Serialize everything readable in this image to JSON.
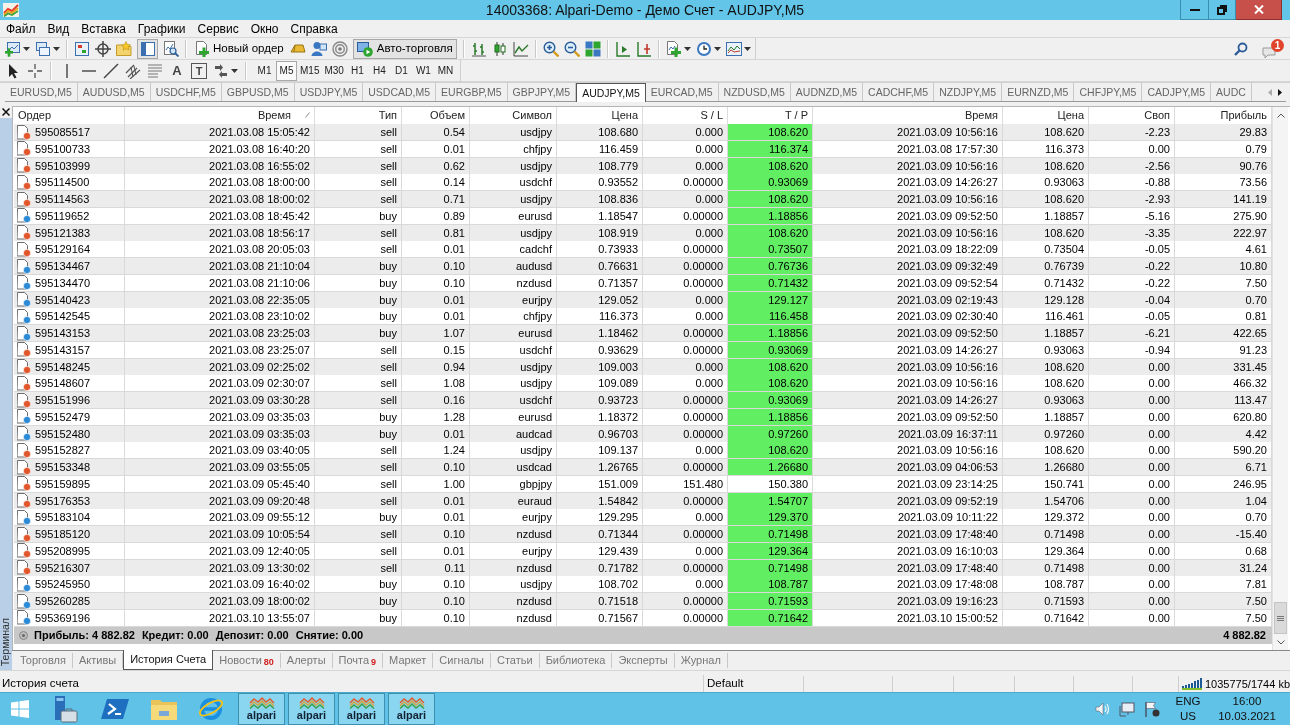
{
  "window": {
    "title": "14003368: Alpari-Demo - Демо Счет - AUDJPY,M5"
  },
  "menu": [
    "Файл",
    "Вид",
    "Вставка",
    "Графики",
    "Сервис",
    "Окно",
    "Справка"
  ],
  "toolbar": {
    "new_order": "Новый ордер",
    "auto_trading": {
      "label": "Авто-торговля",
      "on": true
    },
    "notifications_badge": "1"
  },
  "drawing_toolbar": {
    "text_tool": "A",
    "label_tool": "T",
    "timeframes": [
      {
        "label": "M1",
        "selected": false
      },
      {
        "label": "M5",
        "selected": true
      },
      {
        "label": "M15",
        "selected": false
      },
      {
        "label": "M30",
        "selected": false
      },
      {
        "label": "H1",
        "selected": false
      },
      {
        "label": "H4",
        "selected": false
      },
      {
        "label": "D1",
        "selected": false
      },
      {
        "label": "W1",
        "selected": false
      },
      {
        "label": "MN",
        "selected": false
      }
    ]
  },
  "chart_tabs": [
    {
      "label": "EURUSD,M5",
      "selected": false
    },
    {
      "label": "AUDUSD,M5",
      "selected": false
    },
    {
      "label": "USDCHF,M5",
      "selected": false
    },
    {
      "label": "GBPUSD,M5",
      "selected": false
    },
    {
      "label": "USDJPY,M5",
      "selected": false
    },
    {
      "label": "USDCAD,M5",
      "selected": false
    },
    {
      "label": "EURGBP,M5",
      "selected": false
    },
    {
      "label": "GBPJPY,M5",
      "selected": false
    },
    {
      "label": "AUDJPY,M5",
      "selected": true
    },
    {
      "label": "EURCAD,M5",
      "selected": false
    },
    {
      "label": "NZDUSD,M5",
      "selected": false
    },
    {
      "label": "AUDNZD,M5",
      "selected": false
    },
    {
      "label": "CADCHF,M5",
      "selected": false
    },
    {
      "label": "NZDJPY,M5",
      "selected": false
    },
    {
      "label": "EURNZD,M5",
      "selected": false
    },
    {
      "label": "CHFJPY,M5",
      "selected": false
    },
    {
      "label": "CADJPY,M5",
      "selected": false
    },
    {
      "label": "AUDC",
      "selected": false
    }
  ],
  "terminal": {
    "title": "Терминал",
    "table": {
      "columns": [
        {
          "label": "Ордер",
          "sorted": false
        },
        {
          "label": "Время",
          "sorted": true
        },
        {
          "label": "Тип",
          "sorted": false
        },
        {
          "label": "Объем",
          "sorted": false
        },
        {
          "label": "Символ",
          "sorted": false
        },
        {
          "label": "Цена",
          "sorted": false
        },
        {
          "label": "S / L",
          "sorted": false
        },
        {
          "label": "T / P",
          "sorted": false
        },
        {
          "label": "Время",
          "sorted": false
        },
        {
          "label": "Цена",
          "sorted": false
        },
        {
          "label": "Своп",
          "sorted": false
        },
        {
          "label": "Прибыль",
          "sorted": false
        }
      ],
      "rows": [
        {
          "kind": "sell",
          "order": "595085517",
          "open_time": "2021.03.08 15:05:42",
          "type": "sell",
          "volume": "0.54",
          "symbol": "usdjpy",
          "open_price": "108.680",
          "sl": "0.000",
          "tp": "108.620",
          "tp_hit": true,
          "close_time": "2021.03.09 10:56:16",
          "close_price": "108.620",
          "swap": "-2.23",
          "profit": "29.83"
        },
        {
          "kind": "sell",
          "order": "595100733",
          "open_time": "2021.03.08 16:40:20",
          "type": "sell",
          "volume": "0.01",
          "symbol": "chfjpy",
          "open_price": "116.459",
          "sl": "0.000",
          "tp": "116.374",
          "tp_hit": true,
          "close_time": "2021.03.08 17:57:30",
          "close_price": "116.373",
          "swap": "0.00",
          "profit": "0.79"
        },
        {
          "kind": "sell",
          "order": "595103999",
          "open_time": "2021.03.08 16:55:02",
          "type": "sell",
          "volume": "0.62",
          "symbol": "usdjpy",
          "open_price": "108.779",
          "sl": "0.000",
          "tp": "108.620",
          "tp_hit": true,
          "close_time": "2021.03.09 10:56:16",
          "close_price": "108.620",
          "swap": "-2.56",
          "profit": "90.76"
        },
        {
          "kind": "sell",
          "order": "595114500",
          "open_time": "2021.03.08 18:00:00",
          "type": "sell",
          "volume": "0.14",
          "symbol": "usdchf",
          "open_price": "0.93552",
          "sl": "0.00000",
          "tp": "0.93069",
          "tp_hit": true,
          "close_time": "2021.03.09 14:26:27",
          "close_price": "0.93063",
          "swap": "-0.88",
          "profit": "73.56"
        },
        {
          "kind": "sell",
          "order": "595114563",
          "open_time": "2021.03.08 18:00:02",
          "type": "sell",
          "volume": "0.71",
          "symbol": "usdjpy",
          "open_price": "108.836",
          "sl": "0.000",
          "tp": "108.620",
          "tp_hit": true,
          "close_time": "2021.03.09 10:56:16",
          "close_price": "108.620",
          "swap": "-2.93",
          "profit": "141.19"
        },
        {
          "kind": "buy",
          "order": "595119652",
          "open_time": "2021.03.08 18:45:42",
          "type": "buy",
          "volume": "0.89",
          "symbol": "eurusd",
          "open_price": "1.18547",
          "sl": "0.00000",
          "tp": "1.18856",
          "tp_hit": true,
          "close_time": "2021.03.09 09:52:50",
          "close_price": "1.18857",
          "swap": "-5.16",
          "profit": "275.90"
        },
        {
          "kind": "sell",
          "order": "595121383",
          "open_time": "2021.03.08 18:56:17",
          "type": "sell",
          "volume": "0.81",
          "symbol": "usdjpy",
          "open_price": "108.919",
          "sl": "0.000",
          "tp": "108.620",
          "tp_hit": true,
          "close_time": "2021.03.09 10:56:16",
          "close_price": "108.620",
          "swap": "-3.35",
          "profit": "222.97"
        },
        {
          "kind": "sell",
          "order": "595129164",
          "open_time": "2021.03.08 20:05:03",
          "type": "sell",
          "volume": "0.01",
          "symbol": "cadchf",
          "open_price": "0.73933",
          "sl": "0.00000",
          "tp": "0.73507",
          "tp_hit": true,
          "close_time": "2021.03.09 18:22:09",
          "close_price": "0.73504",
          "swap": "-0.05",
          "profit": "4.61"
        },
        {
          "kind": "buy",
          "order": "595134467",
          "open_time": "2021.03.08 21:10:04",
          "type": "buy",
          "volume": "0.10",
          "symbol": "audusd",
          "open_price": "0.76631",
          "sl": "0.00000",
          "tp": "0.76736",
          "tp_hit": true,
          "close_time": "2021.03.09 09:32:49",
          "close_price": "0.76739",
          "swap": "-0.22",
          "profit": "10.80"
        },
        {
          "kind": "buy",
          "order": "595134470",
          "open_time": "2021.03.08 21:10:06",
          "type": "buy",
          "volume": "0.10",
          "symbol": "nzdusd",
          "open_price": "0.71357",
          "sl": "0.00000",
          "tp": "0.71432",
          "tp_hit": true,
          "close_time": "2021.03.09 09:52:54",
          "close_price": "0.71432",
          "swap": "-0.22",
          "profit": "7.50"
        },
        {
          "kind": "buy",
          "order": "595140423",
          "open_time": "2021.03.08 22:35:05",
          "type": "buy",
          "volume": "0.01",
          "symbol": "eurjpy",
          "open_price": "129.052",
          "sl": "0.000",
          "tp": "129.127",
          "tp_hit": true,
          "close_time": "2021.03.09 02:19:43",
          "close_price": "129.128",
          "swap": "-0.04",
          "profit": "0.70"
        },
        {
          "kind": "buy",
          "order": "595142545",
          "open_time": "2021.03.08 23:10:02",
          "type": "buy",
          "volume": "0.01",
          "symbol": "chfjpy",
          "open_price": "116.373",
          "sl": "0.000",
          "tp": "116.458",
          "tp_hit": true,
          "close_time": "2021.03.09 02:30:40",
          "close_price": "116.461",
          "swap": "-0.05",
          "profit": "0.81"
        },
        {
          "kind": "buy",
          "order": "595143153",
          "open_time": "2021.03.08 23:25:03",
          "type": "buy",
          "volume": "1.07",
          "symbol": "eurusd",
          "open_price": "1.18462",
          "sl": "0.00000",
          "tp": "1.18856",
          "tp_hit": true,
          "close_time": "2021.03.09 09:52:50",
          "close_price": "1.18857",
          "swap": "-6.21",
          "profit": "422.65"
        },
        {
          "kind": "sell",
          "order": "595143157",
          "open_time": "2021.03.08 23:25:07",
          "type": "sell",
          "volume": "0.15",
          "symbol": "usdchf",
          "open_price": "0.93629",
          "sl": "0.00000",
          "tp": "0.93069",
          "tp_hit": true,
          "close_time": "2021.03.09 14:26:27",
          "close_price": "0.93063",
          "swap": "-0.94",
          "profit": "91.23"
        },
        {
          "kind": "sell",
          "order": "595148245",
          "open_time": "2021.03.09 02:25:02",
          "type": "sell",
          "volume": "0.94",
          "symbol": "usdjpy",
          "open_price": "109.003",
          "sl": "0.000",
          "tp": "108.620",
          "tp_hit": true,
          "close_time": "2021.03.09 10:56:16",
          "close_price": "108.620",
          "swap": "0.00",
          "profit": "331.45"
        },
        {
          "kind": "sell",
          "order": "595148607",
          "open_time": "2021.03.09 02:30:07",
          "type": "sell",
          "volume": "1.08",
          "symbol": "usdjpy",
          "open_price": "109.089",
          "sl": "0.000",
          "tp": "108.620",
          "tp_hit": true,
          "close_time": "2021.03.09 10:56:16",
          "close_price": "108.620",
          "swap": "0.00",
          "profit": "466.32"
        },
        {
          "kind": "sell",
          "order": "595151996",
          "open_time": "2021.03.09 03:30:28",
          "type": "sell",
          "volume": "0.16",
          "symbol": "usdchf",
          "open_price": "0.93723",
          "sl": "0.00000",
          "tp": "0.93069",
          "tp_hit": true,
          "close_time": "2021.03.09 14:26:27",
          "close_price": "0.93063",
          "swap": "0.00",
          "profit": "113.47"
        },
        {
          "kind": "buy",
          "order": "595152479",
          "open_time": "2021.03.09 03:35:03",
          "type": "buy",
          "volume": "1.28",
          "symbol": "eurusd",
          "open_price": "1.18372",
          "sl": "0.00000",
          "tp": "1.18856",
          "tp_hit": true,
          "close_time": "2021.03.09 09:52:50",
          "close_price": "1.18857",
          "swap": "0.00",
          "profit": "620.80"
        },
        {
          "kind": "buy",
          "order": "595152480",
          "open_time": "2021.03.09 03:35:03",
          "type": "buy",
          "volume": "0.01",
          "symbol": "audcad",
          "open_price": "0.96703",
          "sl": "0.00000",
          "tp": "0.97260",
          "tp_hit": true,
          "close_time": "2021.03.09 16:37:11",
          "close_price": "0.97260",
          "swap": "0.00",
          "profit": "4.42"
        },
        {
          "kind": "sell",
          "order": "595152827",
          "open_time": "2021.03.09 03:40:05",
          "type": "sell",
          "volume": "1.24",
          "symbol": "usdjpy",
          "open_price": "109.137",
          "sl": "0.000",
          "tp": "108.620",
          "tp_hit": true,
          "close_time": "2021.03.09 10:56:16",
          "close_price": "108.620",
          "swap": "0.00",
          "profit": "590.20"
        },
        {
          "kind": "sell",
          "order": "595153348",
          "open_time": "2021.03.09 03:55:05",
          "type": "sell",
          "volume": "0.10",
          "symbol": "usdcad",
          "open_price": "1.26765",
          "sl": "0.00000",
          "tp": "1.26680",
          "tp_hit": true,
          "close_time": "2021.03.09 04:06:53",
          "close_price": "1.26680",
          "swap": "0.00",
          "profit": "6.71"
        },
        {
          "kind": "sell",
          "order": "595159895",
          "open_time": "2021.03.09 05:45:40",
          "type": "sell",
          "volume": "1.00",
          "symbol": "gbpjpy",
          "open_price": "151.009",
          "sl": "151.480",
          "tp": "150.380",
          "tp_hit": false,
          "close_time": "2021.03.09 23:14:25",
          "close_price": "150.741",
          "swap": "0.00",
          "profit": "246.95"
        },
        {
          "kind": "sell",
          "order": "595176353",
          "open_time": "2021.03.09 09:20:48",
          "type": "sell",
          "volume": "0.01",
          "symbol": "euraud",
          "open_price": "1.54842",
          "sl": "0.00000",
          "tp": "1.54707",
          "tp_hit": true,
          "close_time": "2021.03.09 09:52:19",
          "close_price": "1.54706",
          "swap": "0.00",
          "profit": "1.04"
        },
        {
          "kind": "buy",
          "order": "595183104",
          "open_time": "2021.03.09 09:55:12",
          "type": "buy",
          "volume": "0.01",
          "symbol": "eurjpy",
          "open_price": "129.295",
          "sl": "0.000",
          "tp": "129.370",
          "tp_hit": true,
          "close_time": "2021.03.09 10:11:22",
          "close_price": "129.372",
          "swap": "0.00",
          "profit": "0.70"
        },
        {
          "kind": "sell",
          "order": "595185120",
          "open_time": "2021.03.09 10:05:54",
          "type": "sell",
          "volume": "0.10",
          "symbol": "nzdusd",
          "open_price": "0.71344",
          "sl": "0.00000",
          "tp": "0.71498",
          "tp_hit": true,
          "close_time": "2021.03.09 17:48:40",
          "close_price": "0.71498",
          "swap": "0.00",
          "profit": "-15.40"
        },
        {
          "kind": "sell",
          "order": "595208995",
          "open_time": "2021.03.09 12:40:05",
          "type": "sell",
          "volume": "0.01",
          "symbol": "eurjpy",
          "open_price": "129.439",
          "sl": "0.000",
          "tp": "129.364",
          "tp_hit": true,
          "close_time": "2021.03.09 16:10:03",
          "close_price": "129.364",
          "swap": "0.00",
          "profit": "0.68"
        },
        {
          "kind": "sell",
          "order": "595216307",
          "open_time": "2021.03.09 13:30:02",
          "type": "sell",
          "volume": "0.11",
          "symbol": "nzdusd",
          "open_price": "0.71782",
          "sl": "0.00000",
          "tp": "0.71498",
          "tp_hit": true,
          "close_time": "2021.03.09 17:48:40",
          "close_price": "0.71498",
          "swap": "0.00",
          "profit": "31.24"
        },
        {
          "kind": "buy",
          "order": "595245950",
          "open_time": "2021.03.09 16:40:02",
          "type": "buy",
          "volume": "0.10",
          "symbol": "usdjpy",
          "open_price": "108.702",
          "sl": "0.000",
          "tp": "108.787",
          "tp_hit": true,
          "close_time": "2021.03.09 17:48:08",
          "close_price": "108.787",
          "swap": "0.00",
          "profit": "7.81"
        },
        {
          "kind": "buy",
          "order": "595260285",
          "open_time": "2021.03.09 18:00:02",
          "type": "buy",
          "volume": "0.10",
          "symbol": "nzdusd",
          "open_price": "0.71518",
          "sl": "0.00000",
          "tp": "0.71593",
          "tp_hit": true,
          "close_time": "2021.03.09 19:16:23",
          "close_price": "0.71593",
          "swap": "0.00",
          "profit": "7.50"
        },
        {
          "kind": "buy",
          "order": "595369196",
          "open_time": "2021.03.10 13:55:07",
          "type": "buy",
          "volume": "0.10",
          "symbol": "nzdusd",
          "open_price": "0.71567",
          "sl": "0.00000",
          "tp": "0.71642",
          "tp_hit": true,
          "close_time": "2021.03.10 15:00:52",
          "close_price": "0.71642",
          "swap": "0.00",
          "profit": "7.50"
        }
      ]
    },
    "summary": {
      "items": [
        "Прибыль: 4 882.82",
        "Кредит: 0.00",
        "Депозит: 0.00",
        "Снятие: 0.00"
      ],
      "total": "4 882.82"
    },
    "tabs": [
      {
        "label": "Торговля",
        "selected": false
      },
      {
        "label": "Активы",
        "selected": false
      },
      {
        "label": "История Счета",
        "selected": true
      },
      {
        "label": "Новости",
        "badge": "80",
        "selected": false
      },
      {
        "label": "Алерты",
        "selected": false
      },
      {
        "label": "Почта",
        "badge": "9",
        "selected": false
      },
      {
        "label": "Маркет",
        "selected": false
      },
      {
        "label": "Сигналы",
        "selected": false
      },
      {
        "label": "Статьи",
        "selected": false
      },
      {
        "label": "Библиотека",
        "selected": false
      },
      {
        "label": "Эксперты",
        "selected": false
      },
      {
        "label": "Журнал",
        "selected": false
      }
    ]
  },
  "status_bar": {
    "text": "История счета",
    "profile": "Default",
    "traffic": "1035775/1744 kb"
  },
  "taskbar": {
    "windows": [
      {
        "label": "alpari"
      },
      {
        "label": "alpari"
      },
      {
        "label": "alpari"
      },
      {
        "label": "alpari"
      }
    ],
    "language": "ENG",
    "region": "US",
    "time": "16:00",
    "date": "10.03.2021"
  }
}
